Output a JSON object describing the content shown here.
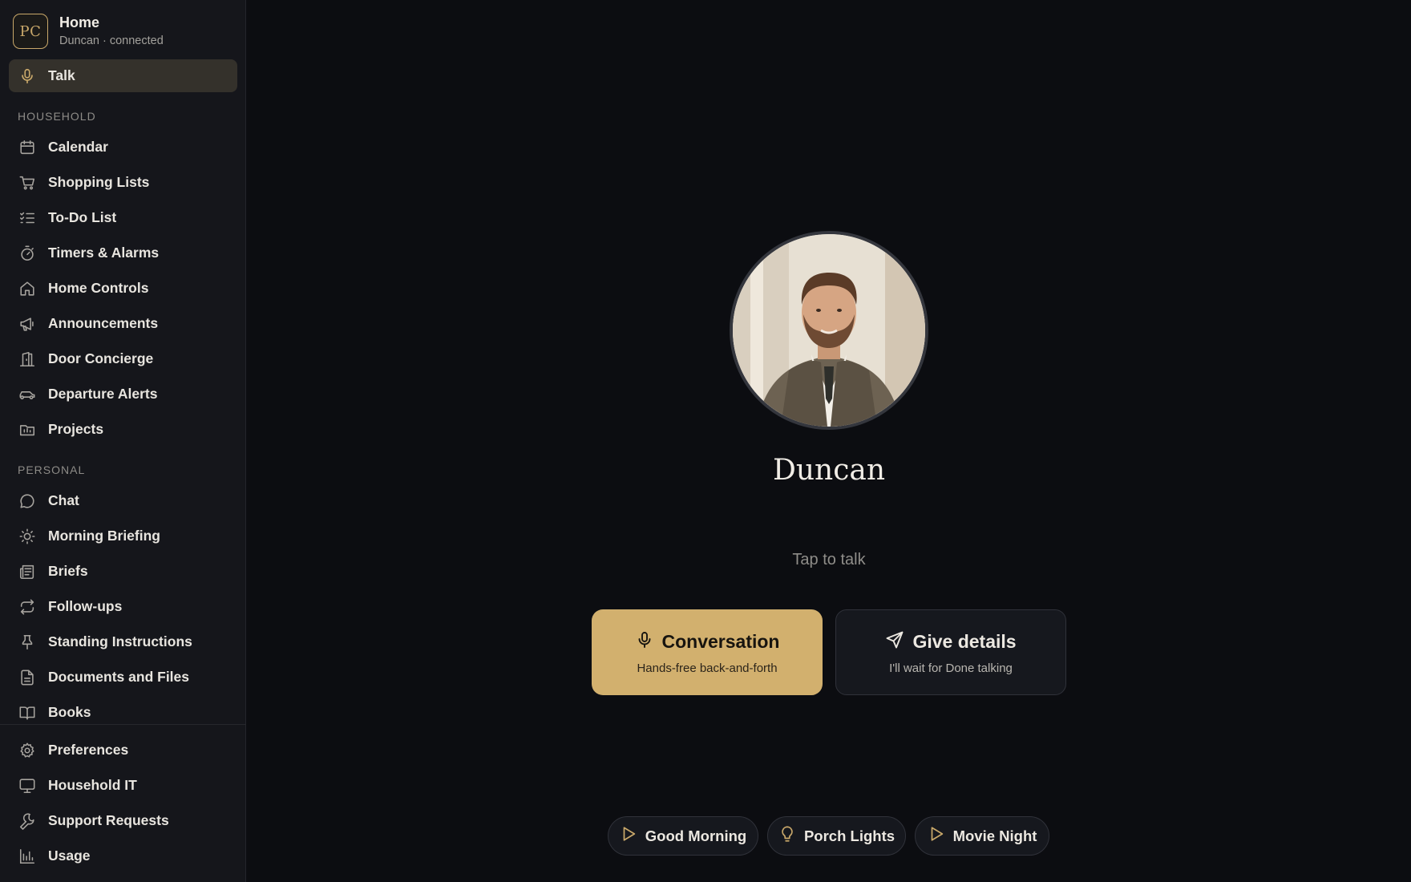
{
  "sidebar": {
    "brand": {
      "logo": "PC",
      "title": "Home",
      "subtitle": "Duncan · connected"
    },
    "talk": {
      "label": "Talk",
      "icon": "microphone-icon"
    },
    "sections": {
      "household": "HOUSEHOLD",
      "personal": "PERSONAL"
    },
    "household_items": [
      {
        "label": "Calendar",
        "icon": "calendar-icon"
      },
      {
        "label": "Shopping Lists",
        "icon": "cart-icon"
      },
      {
        "label": "To-Do List",
        "icon": "checklist-icon"
      },
      {
        "label": "Timers & Alarms",
        "icon": "stopwatch-icon"
      },
      {
        "label": "Home Controls",
        "icon": "house-icon"
      },
      {
        "label": "Announcements",
        "icon": "megaphone-icon"
      },
      {
        "label": "Door Concierge",
        "icon": "door-icon"
      },
      {
        "label": "Departure Alerts",
        "icon": "car-icon"
      },
      {
        "label": "Projects",
        "icon": "folder-chart-icon"
      }
    ],
    "personal_items": [
      {
        "label": "Chat",
        "icon": "chat-bubble-icon"
      },
      {
        "label": "Morning Briefing",
        "icon": "sun-icon"
      },
      {
        "label": "Briefs",
        "icon": "newspaper-icon"
      },
      {
        "label": "Follow-ups",
        "icon": "repeat-icon"
      },
      {
        "label": "Standing Instructions",
        "icon": "pin-icon"
      },
      {
        "label": "Documents and Files",
        "icon": "document-icon"
      },
      {
        "label": "Books",
        "icon": "book-icon"
      }
    ],
    "footer_items": [
      {
        "label": "Preferences",
        "icon": "gear-icon"
      },
      {
        "label": "Household IT",
        "icon": "monitor-icon"
      },
      {
        "label": "Support Requests",
        "icon": "wrench-icon"
      },
      {
        "label": "Usage",
        "icon": "bar-chart-icon"
      }
    ]
  },
  "main": {
    "agent_name": "Duncan",
    "hint": "Tap to talk",
    "modes": {
      "conversation": {
        "title": "Conversation",
        "subtitle": "Hands-free back-and-forth",
        "icon": "microphone-icon"
      },
      "details": {
        "title": "Give details",
        "subtitle": "I'll wait for Done talking",
        "icon": "send-icon"
      }
    },
    "quick_actions": [
      {
        "label": "Good Morning",
        "icon": "play-icon"
      },
      {
        "label": "Porch Lights",
        "icon": "lightbulb-icon"
      },
      {
        "label": "Movie Night",
        "icon": "play-icon"
      }
    ]
  },
  "colors": {
    "accent": "#d2b06e",
    "background": "#0c0d11",
    "sidebar": "#15161b",
    "active_item": "#34312b"
  }
}
